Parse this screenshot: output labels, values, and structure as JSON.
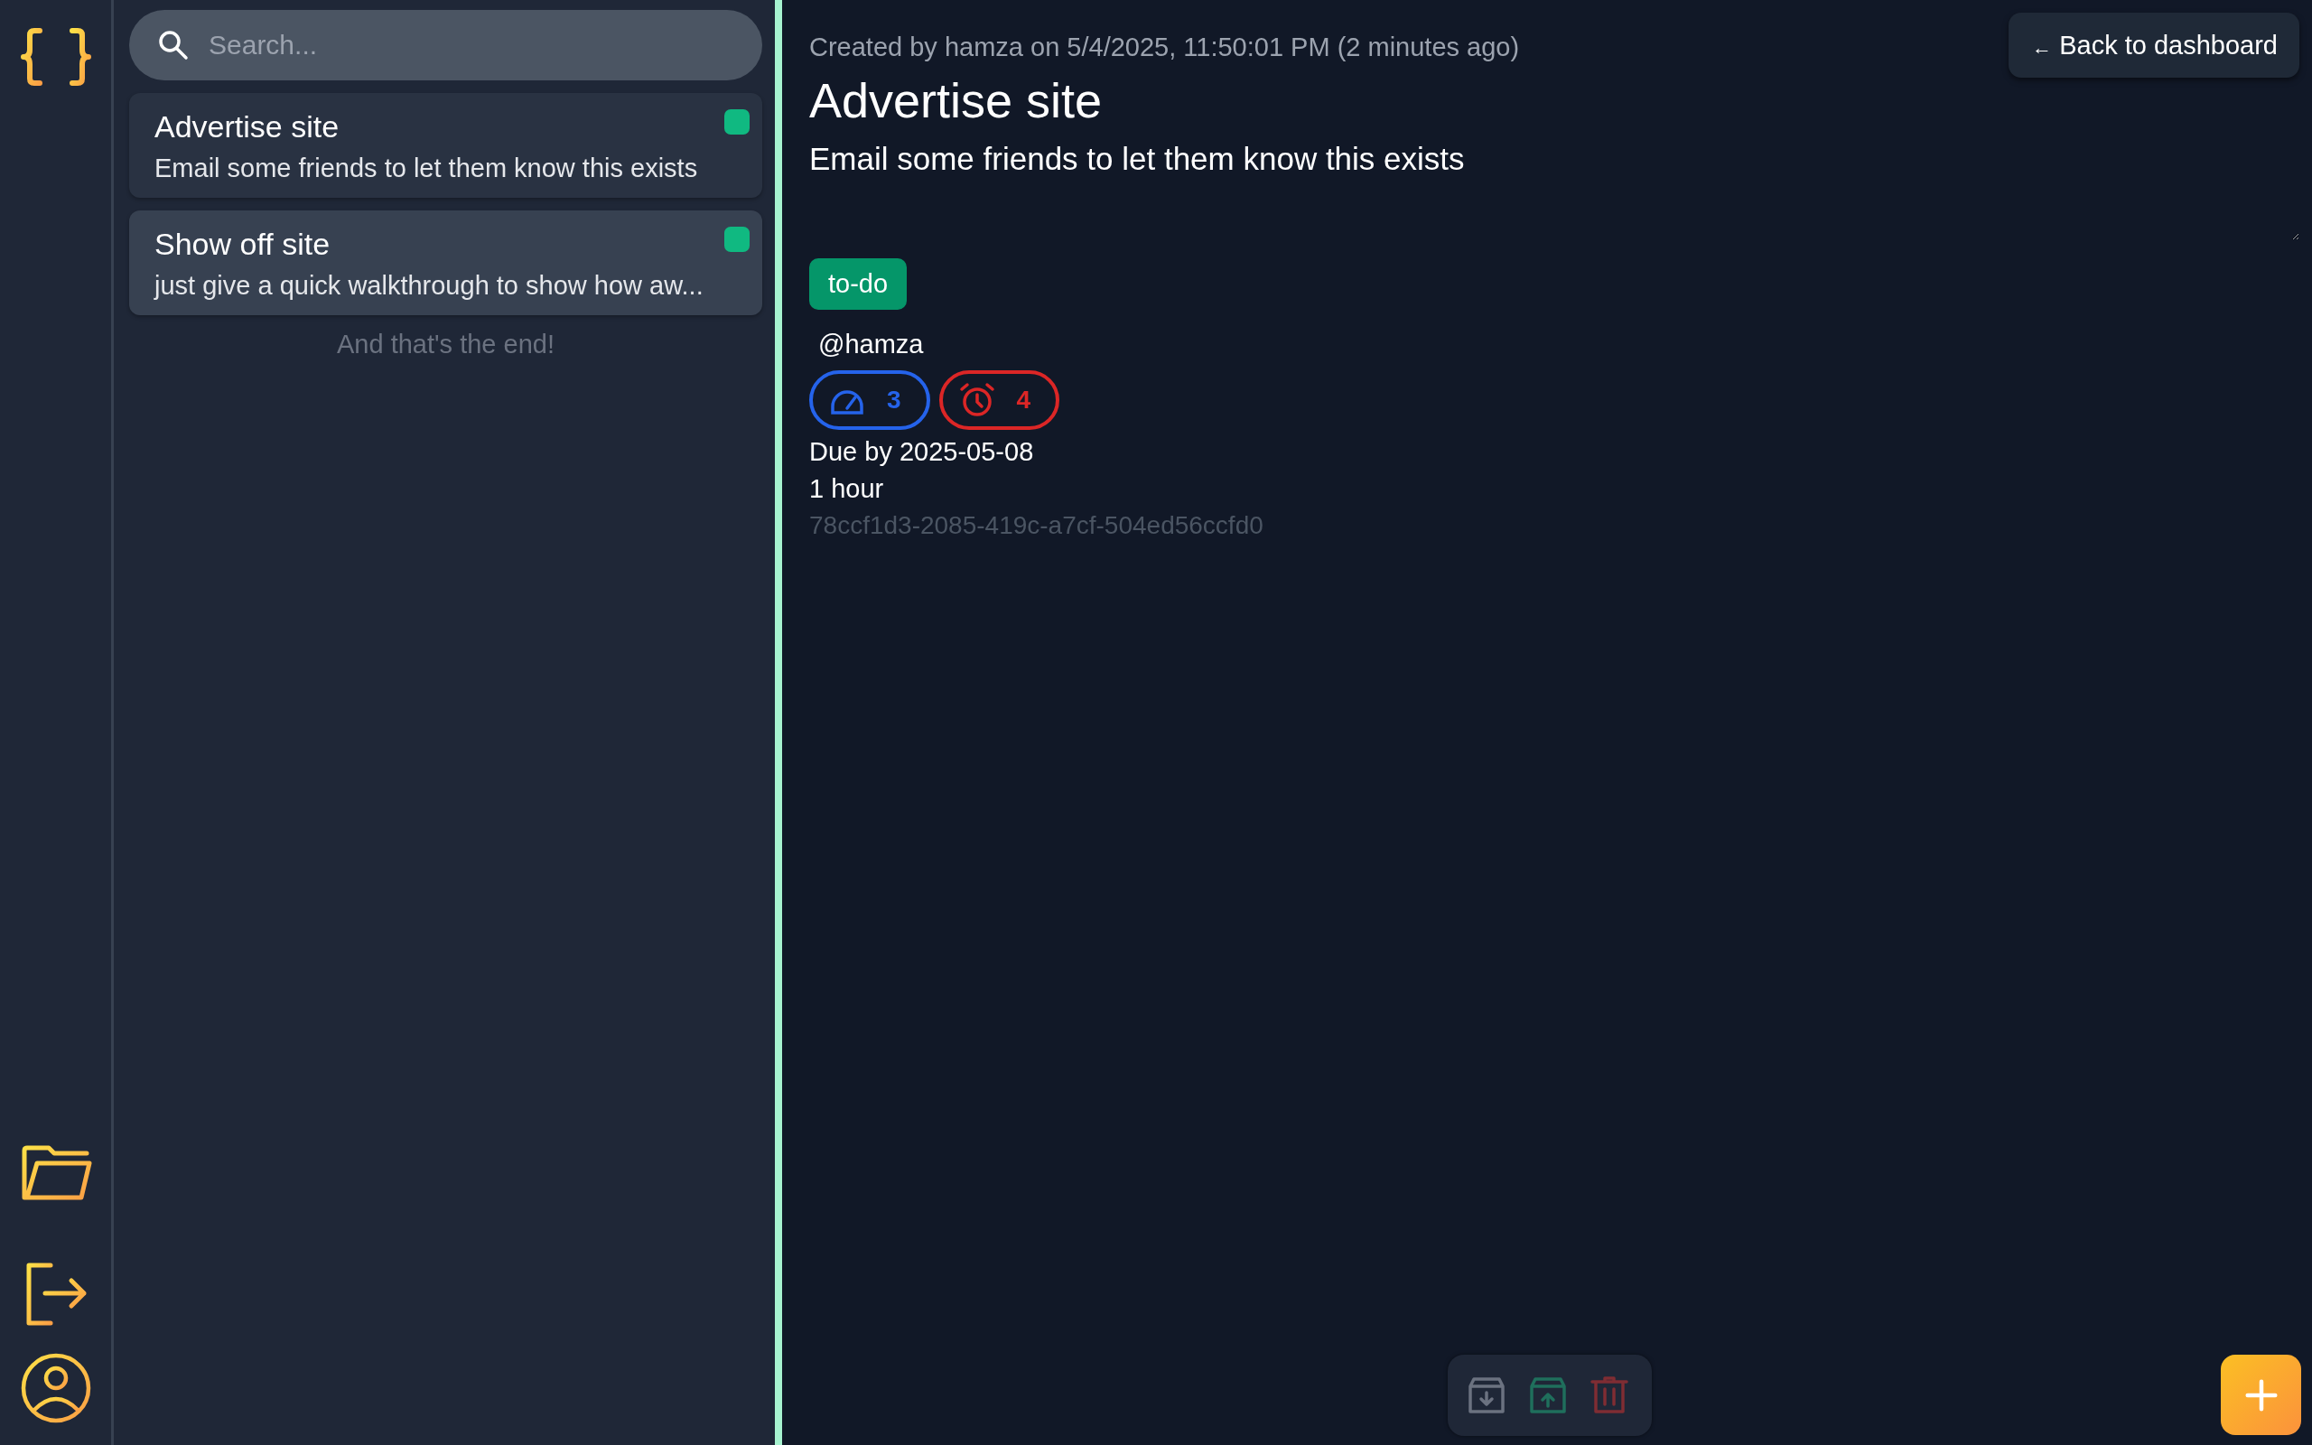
{
  "search": {
    "placeholder": "Search..."
  },
  "tasks": [
    {
      "title": "Advertise site",
      "description": "Email some friends to let them know this exists",
      "color": "#10b981",
      "selected": true
    },
    {
      "title": "Show off site",
      "description": "just give a quick walkthrough to show how aw...",
      "color": "#10b981",
      "selected": false
    }
  ],
  "list_end": "And that's the end!",
  "detail": {
    "meta": "Created by hamza on 5/4/2025, 11:50:01 PM (2 minutes ago)",
    "title": "Advertise site",
    "description": "Email some friends to let them know this exists",
    "tag": {
      "label": "to-do",
      "color": "#059669"
    },
    "assignee": "@hamza",
    "pills": [
      {
        "kind": "priority",
        "value": "3",
        "color": "#2563eb"
      },
      {
        "kind": "alarm",
        "value": "4",
        "color": "#dc2626"
      }
    ],
    "due": "Due by 2025-05-08",
    "estimate": "1 hour",
    "id": "78ccf1d3-2085-419c-a7cf-504ed56ccfd0"
  },
  "back_button": {
    "arrow": "←",
    "label": "Back to dashboard"
  },
  "toolbar": [
    {
      "kind": "archive",
      "color": "#6b7280"
    },
    {
      "kind": "unarchive",
      "color": "#1f6f5c"
    },
    {
      "kind": "delete",
      "color": "#7f2d33"
    }
  ]
}
